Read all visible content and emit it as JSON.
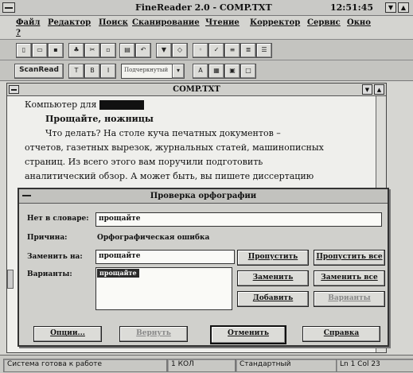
{
  "window": {
    "title": "FineReader 2.0 - COMP.TXT",
    "clock": "12:51:45",
    "min_glyph": "▼",
    "max_glyph": "▲"
  },
  "menu": [
    "Файл",
    "Редактор",
    "Поиск",
    "Сканирование",
    "Чтение",
    "Корректор",
    "Сервис",
    "Окно",
    "?"
  ],
  "toolbar": {
    "scan_label": "ScanRead",
    "style_value": "Подчеркнутый"
  },
  "document": {
    "title": "COMP.TXT",
    "lines": [
      "Компьютер для",
      "Прощайте, ножницы",
      "Что делать? На столе куча печатных документов –",
      "отчетов, газетных вырезок, журнальных статей, машинописных",
      "страниц. Из всего этого вам поручили подготовить",
      "аналитический обзор. А может быть, вы пишете диссертацию"
    ]
  },
  "dialog": {
    "title": "Проверка орфографии",
    "not_in_dict_label": "Нет в словаре:",
    "not_in_dict_value": "прощайте",
    "reason_label": "Причина:",
    "reason_value": "Орфографическая ошибка",
    "replace_label": "Заменить на:",
    "replace_value": "прощайте",
    "variants_label": "Варианты:",
    "variants": [
      "прощайте"
    ],
    "buttons": {
      "skip": "Пропустить",
      "skip_all": "Пропустить все",
      "replace": "Заменить",
      "replace_all": "Заменить все",
      "add": "Добавить",
      "variants": "Варианты",
      "options": "Опции...",
      "undo": "Вернуть",
      "cancel": "Отменить",
      "help": "Справка"
    }
  },
  "status": {
    "message": "Система готова к работе",
    "lang": "1 КОЛ",
    "style": "Стандартный",
    "position": "Ln 1 Col 23"
  }
}
